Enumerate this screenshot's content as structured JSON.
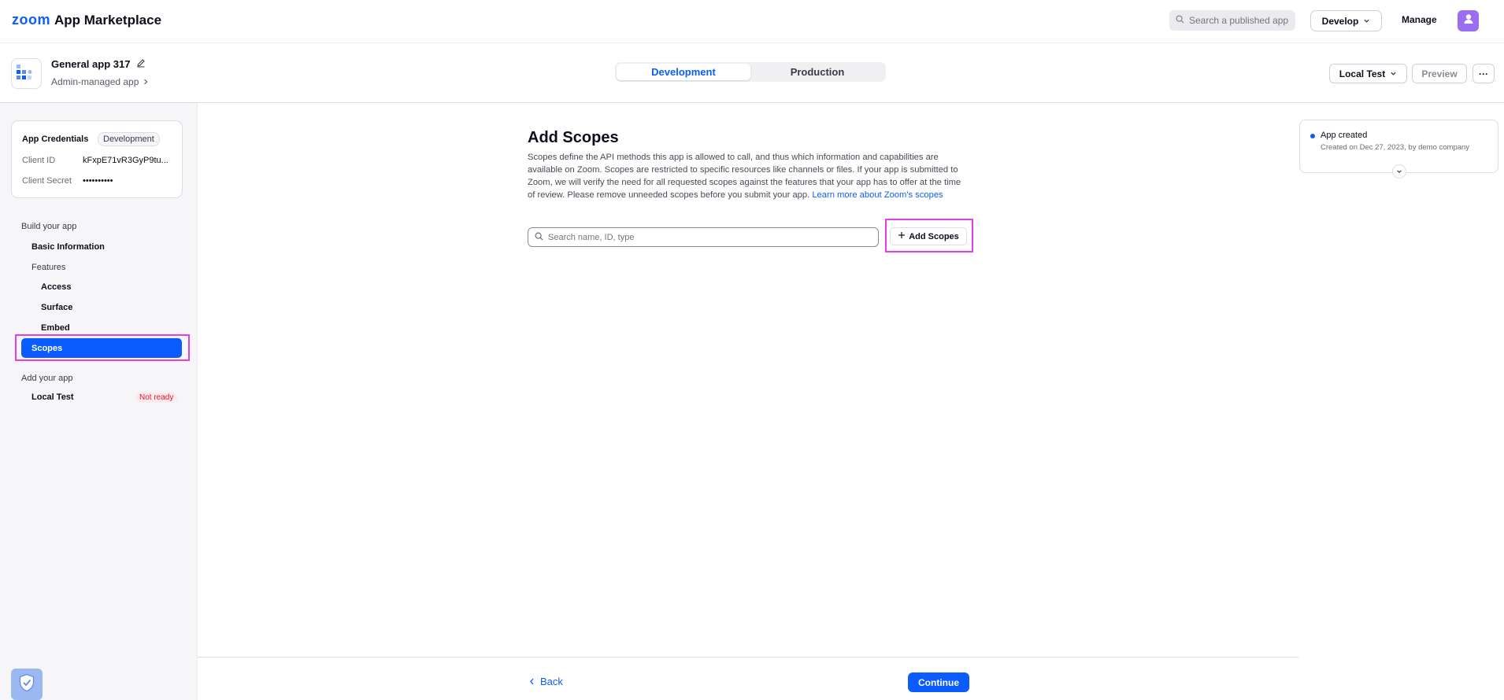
{
  "header": {
    "brand_logo": "zoom",
    "brand_title": "App Marketplace",
    "search_placeholder": "Search a published app",
    "develop_label": "Develop",
    "manage_label": "Manage"
  },
  "app": {
    "name": "General app 317",
    "subtitle": "Admin-managed app",
    "environments": [
      "Development",
      "Production"
    ],
    "active_environment": "Development",
    "local_test_label": "Local Test",
    "preview_label": "Preview",
    "more_label": "···"
  },
  "credentials": {
    "title": "App Credentials",
    "badge": "Development",
    "client_id_label": "Client ID",
    "client_id_value": "kFxpE71vR3GyP9tu...",
    "client_secret_label": "Client Secret",
    "client_secret_value": "••••••••••"
  },
  "sidebar": {
    "build_section": "Build your app",
    "basic_information": "Basic Information",
    "features": "Features",
    "access": "Access",
    "surface": "Surface",
    "embed": "Embed",
    "scopes": "Scopes",
    "add_section": "Add your app",
    "local_test": "Local Test",
    "not_ready": "Not ready"
  },
  "main": {
    "title": "Add Scopes",
    "description": "Scopes define the API methods this app is allowed to call, and thus which information and capabilities are available on Zoom. Scopes are restricted to specific resources like channels or files. If your app is submitted to Zoom, we will verify the need for all requested scopes against the features that your app has to offer at the time of review. Please remove unneeded scopes before you submit your app. ",
    "learn_more": "Learn more about Zoom's scopes",
    "search_placeholder": "Search name, ID, type",
    "add_scopes_label": "Add Scopes"
  },
  "activity": {
    "title": "App created",
    "subtitle": "Created on Dec 27, 2023, by demo company"
  },
  "footer": {
    "back_label": "Back",
    "continue_label": "Continue"
  },
  "colors": {
    "accent": "#0b5cff",
    "highlight": "#e63ee0",
    "not_ready_text": "#d6203a",
    "not_ready_bg": "#fde8ec"
  }
}
